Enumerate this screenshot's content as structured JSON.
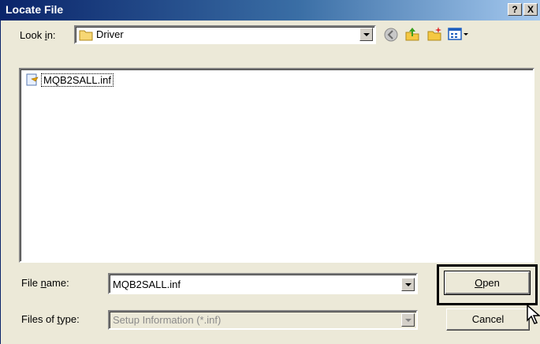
{
  "window": {
    "title": "Locate File",
    "help_glyph": "?",
    "close_glyph": "X"
  },
  "lookin": {
    "label_pre": "Look ",
    "label_key": "i",
    "label_post": "n:",
    "folder": "Driver",
    "icons": [
      "folder-icon",
      "back-icon",
      "up-folder-icon",
      "new-folder-icon",
      "view-menu-icon"
    ]
  },
  "files": [
    {
      "name": "MQB2SALL.inf",
      "icon": "inf-file-icon"
    }
  ],
  "filename": {
    "label_pre": "File ",
    "label_key": "n",
    "label_post": "ame:",
    "value": "MQB2SALL.inf"
  },
  "filetype": {
    "label_pre": "Files of ",
    "label_key": "t",
    "label_post": "ype:",
    "value": "Setup Information (*.inf)"
  },
  "buttons": {
    "open_key": "O",
    "open_rest": "pen",
    "cancel": "Cancel"
  },
  "colors": {
    "title_start": "#0a246a",
    "title_end": "#a6caf0",
    "dialog_bg": "#ece9d8"
  }
}
